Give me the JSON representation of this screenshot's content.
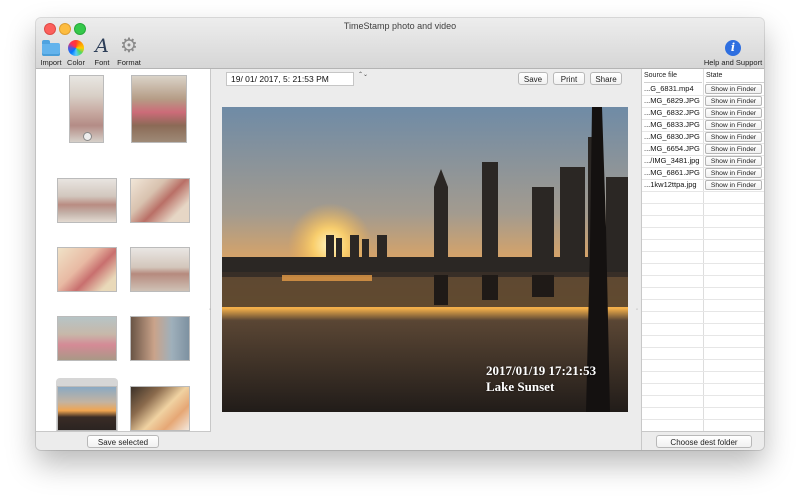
{
  "window": {
    "title": "TimeStamp photo and video"
  },
  "toolbar": {
    "items": [
      {
        "label": "Import",
        "icon": "folder-icon"
      },
      {
        "label": "Color",
        "icon": "color-wheel-icon"
      },
      {
        "label": "Font",
        "icon": "font-icon"
      },
      {
        "label": "Format",
        "icon": "gear-icon"
      }
    ],
    "help_label": "Help and Support",
    "help_glyph": "i"
  },
  "left_panel": {
    "selected_index": 8,
    "save_selected_label": "Save selected"
  },
  "center": {
    "date_value": "19/ 01/ 2017,   5: 21:53 PM",
    "stepper_glyph": "⌃⌄",
    "save_label": "Save",
    "print_label": "Print",
    "share_label": "Share",
    "stamp_datetime": "2017/01/19 17:21:53",
    "stamp_caption": "Lake Sunset"
  },
  "files": {
    "columns": [
      "Source file",
      "State"
    ],
    "rows": [
      {
        "name": "...G_6831.mp4",
        "state": "Show in Finder"
      },
      {
        "name": "...MG_6829.JPG",
        "state": "Show in Finder"
      },
      {
        "name": "...MG_6832.JPG",
        "state": "Show in Finder"
      },
      {
        "name": "...MG_6833.JPG",
        "state": "Show in Finder"
      },
      {
        "name": "...MG_6830.JPG",
        "state": "Show in Finder"
      },
      {
        "name": "...MG_6654.JPG",
        "state": "Show in Finder"
      },
      {
        "name": ".../IMG_3481.jpg",
        "state": "Show in Finder"
      },
      {
        "name": "...MG_6861.JPG",
        "state": "Show in Finder"
      },
      {
        "name": "...1kw12ttpa.jpg",
        "state": "Show in Finder"
      }
    ],
    "choose_dest_label": "Choose dest folder"
  },
  "colors": {
    "accent": "#2f6fe0",
    "window_bg": "#ececec"
  }
}
